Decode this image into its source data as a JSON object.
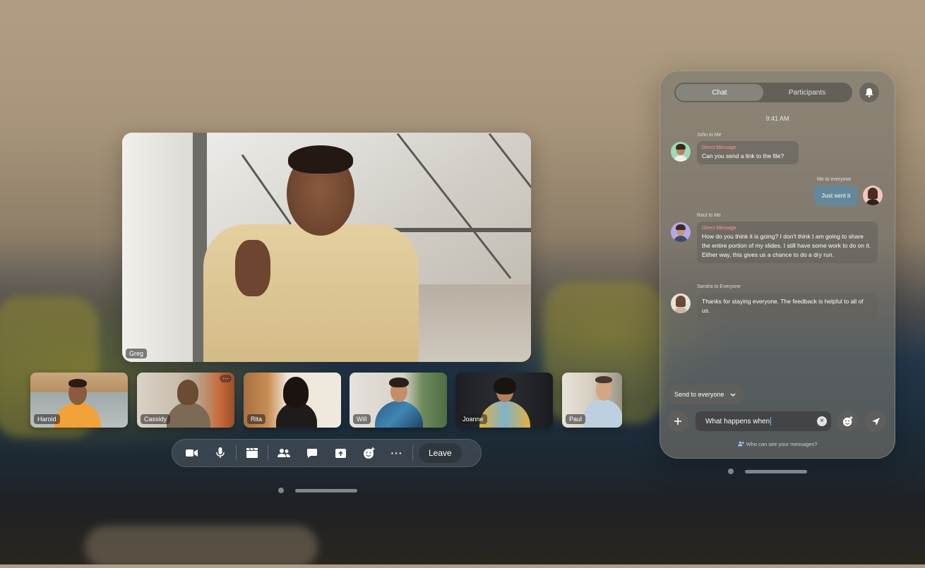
{
  "main_video": {
    "name": "Greg"
  },
  "thumbnails": [
    {
      "name": "Haroid"
    },
    {
      "name": "Cassidy",
      "more": "···"
    },
    {
      "name": "Rita"
    },
    {
      "name": "Will"
    },
    {
      "name": "Joanne"
    },
    {
      "name": "Paul"
    }
  ],
  "toolbar": {
    "icons": [
      "video-icon",
      "mic-icon",
      "scene-icon",
      "people-icon",
      "chat-icon",
      "share-icon",
      "reaction-icon",
      "more-icon"
    ],
    "more_label": "···",
    "leave_label": "Leave"
  },
  "chat": {
    "tabs": [
      "Chat",
      "Participants"
    ],
    "active_tab": "Chat",
    "time": "9:41 AM",
    "messages": [
      {
        "meta": "John to Me",
        "tag": "Direct Message",
        "text": "Can you send a link to the file?"
      },
      {
        "meta": "Me to everyone",
        "text": "Just sent it"
      },
      {
        "meta": "Raul to Me",
        "tag": "Direct Message",
        "text": "How do you think it is going? I don't think I am going to share the entire portion of my slides. I still have some work to do on it. Either way, this gives us a chance to do a dry run."
      },
      {
        "meta": "Sandra to Everyone",
        "text": "Thanks for staying everyone. The feedback is helpful to all of us."
      }
    ],
    "send_to": "Send to everyone",
    "input_value": "What happens when",
    "privacy_text": "Who can see your messages?"
  },
  "colors": {
    "accent_dm": "#ff9a8a",
    "own_bubble": "#5a8caa",
    "caret": "#6bb6ff"
  }
}
